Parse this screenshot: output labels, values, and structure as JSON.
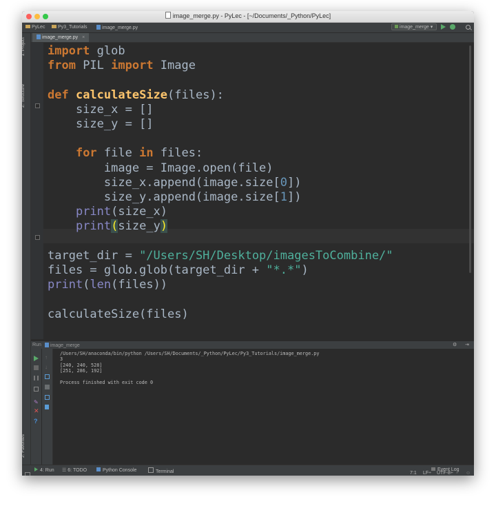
{
  "window": {
    "title": "image_merge.py - PyLec - [~/Documents/_Python/PyLec]"
  },
  "navbar": {
    "crumbs": [
      "PyLec",
      "Py3_Tutorials",
      "image_merge.py"
    ],
    "run_config": "image_merge"
  },
  "left_strip": {
    "project": "1: Project",
    "structure": "Z: Structure",
    "favorites": "2: Favorites"
  },
  "editor": {
    "tab_label": "image_merge.py",
    "tab_close": "×",
    "cursor_position": "7:1"
  },
  "run_panel": {
    "header_prefix": "Run",
    "config": "image_merge",
    "console_lines": [
      "/Users/SH/anaconda/bin/python /Users/SH/Documents/_Python/PyLec/Py3_Tutorials/image_merge.py",
      "3",
      "[240, 240, 528]",
      "[251, 286, 192]",
      "",
      "Process finished with exit code 0"
    ]
  },
  "bottom_tabs": {
    "run": "4: Run",
    "todo": "6: TODO",
    "python_console": "Python Console",
    "terminal": "Terminal",
    "event_log": "Event Log"
  },
  "status": {
    "position": "7:1",
    "line_sep": "LF÷",
    "encoding": "UTF-8÷"
  },
  "colors": {
    "keyword": "#cc7832",
    "function": "#ffc66d",
    "string": "#4fb09c",
    "builtin": "#8888c6",
    "number": "#6897bb",
    "text": "#a9b7c6",
    "background": "#2b2b2b"
  }
}
